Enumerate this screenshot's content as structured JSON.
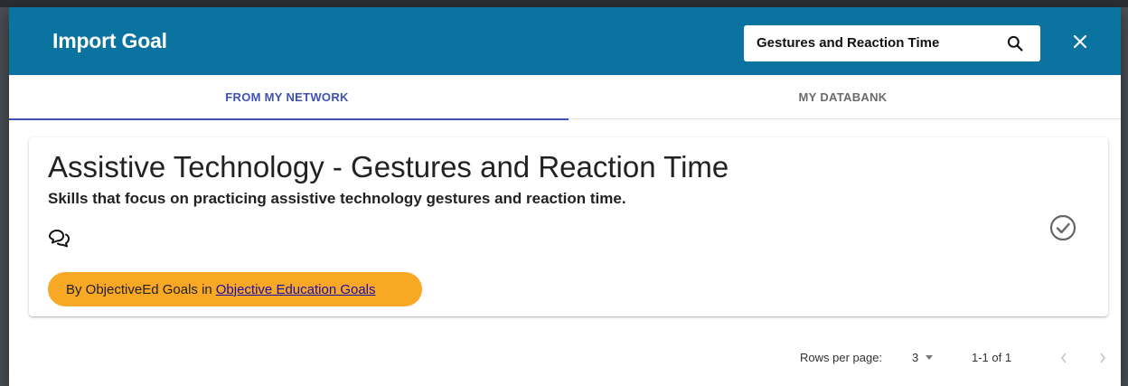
{
  "header": {
    "title": "Import Goal",
    "search": {
      "value": "Gestures and Reaction Time",
      "placeholder": "Search"
    },
    "close_icon": "close-icon",
    "color": "#0a739f"
  },
  "tabs": [
    {
      "label": "FROM MY NETWORK",
      "active": true
    },
    {
      "label": "MY DATABANK",
      "active": false
    }
  ],
  "card": {
    "title": "Assistive Technology - Gestures and Reaction Time",
    "description": "Skills that focus on practicing assistive technology gestures and reaction time.",
    "comment_icon": "comment-icon",
    "select_icon": "check-circle-icon",
    "badge": {
      "prefix": "By ObjectiveEd Goals in",
      "link": "Objective Education Goals",
      "color": "#f9a825"
    }
  },
  "pagination": {
    "rows_label": "Rows per page:",
    "rows_value": "3",
    "range": "1-1 of 1",
    "prev_icon": "chevron-left-icon",
    "next_icon": "chevron-right-icon"
  }
}
